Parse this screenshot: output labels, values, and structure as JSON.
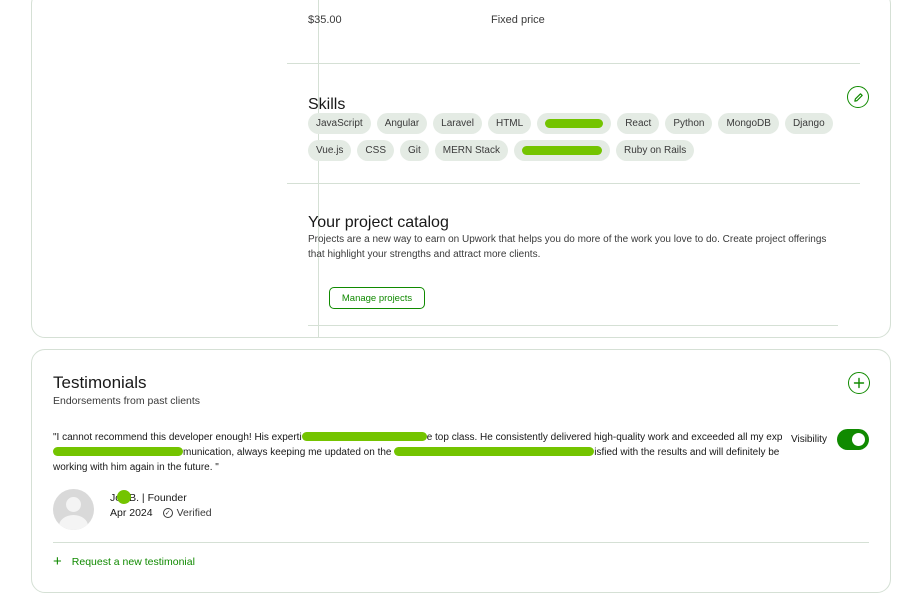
{
  "pricing": {
    "rate": "$35.00",
    "type": "Fixed price"
  },
  "skills": {
    "title": "Skills",
    "edit_icon": "pencil-icon",
    "row1": [
      "JavaScript",
      "Angular",
      "Laravel",
      "HTML",
      "",
      "React",
      "Python",
      "MongoDB",
      "Django"
    ],
    "row2": [
      "Vue.js",
      "CSS",
      "Git",
      "MERN Stack",
      "",
      "Ruby on Rails"
    ]
  },
  "catalog": {
    "title": "Your project catalog",
    "description": "Projects are a new way to earn on Upwork that helps you do more of the work you love to do. Create project offerings that highlight your strengths and attract more clients.",
    "button_label": "Manage projects"
  },
  "testimonials": {
    "title": "Testimonials",
    "subtitle": "Endorsements from past clients",
    "add_icon": "plus-icon",
    "quote_part1": "\"I cannot recommend this developer enough! His experti",
    "quote_part2": "e top class. He consistently delivered high-quality work and exceeded all my exp",
    "quote_part3": "munication, always keeping me updated on the ",
    "quote_part4": "isfied with the results and will definitely be working with him again in the future. \"",
    "visibility_label": "Visibility",
    "visibility_on": true,
    "author_prefix": "Jo",
    "author_suffix": "B. | Founder",
    "date": "Apr 2024",
    "verified": "Verified",
    "request_label": "Request a new testimonial"
  },
  "colors": {
    "accent": "#108a00",
    "chip_bg": "#e4ebe4",
    "redaction": "#74c400",
    "border": "#d5e0d5"
  }
}
